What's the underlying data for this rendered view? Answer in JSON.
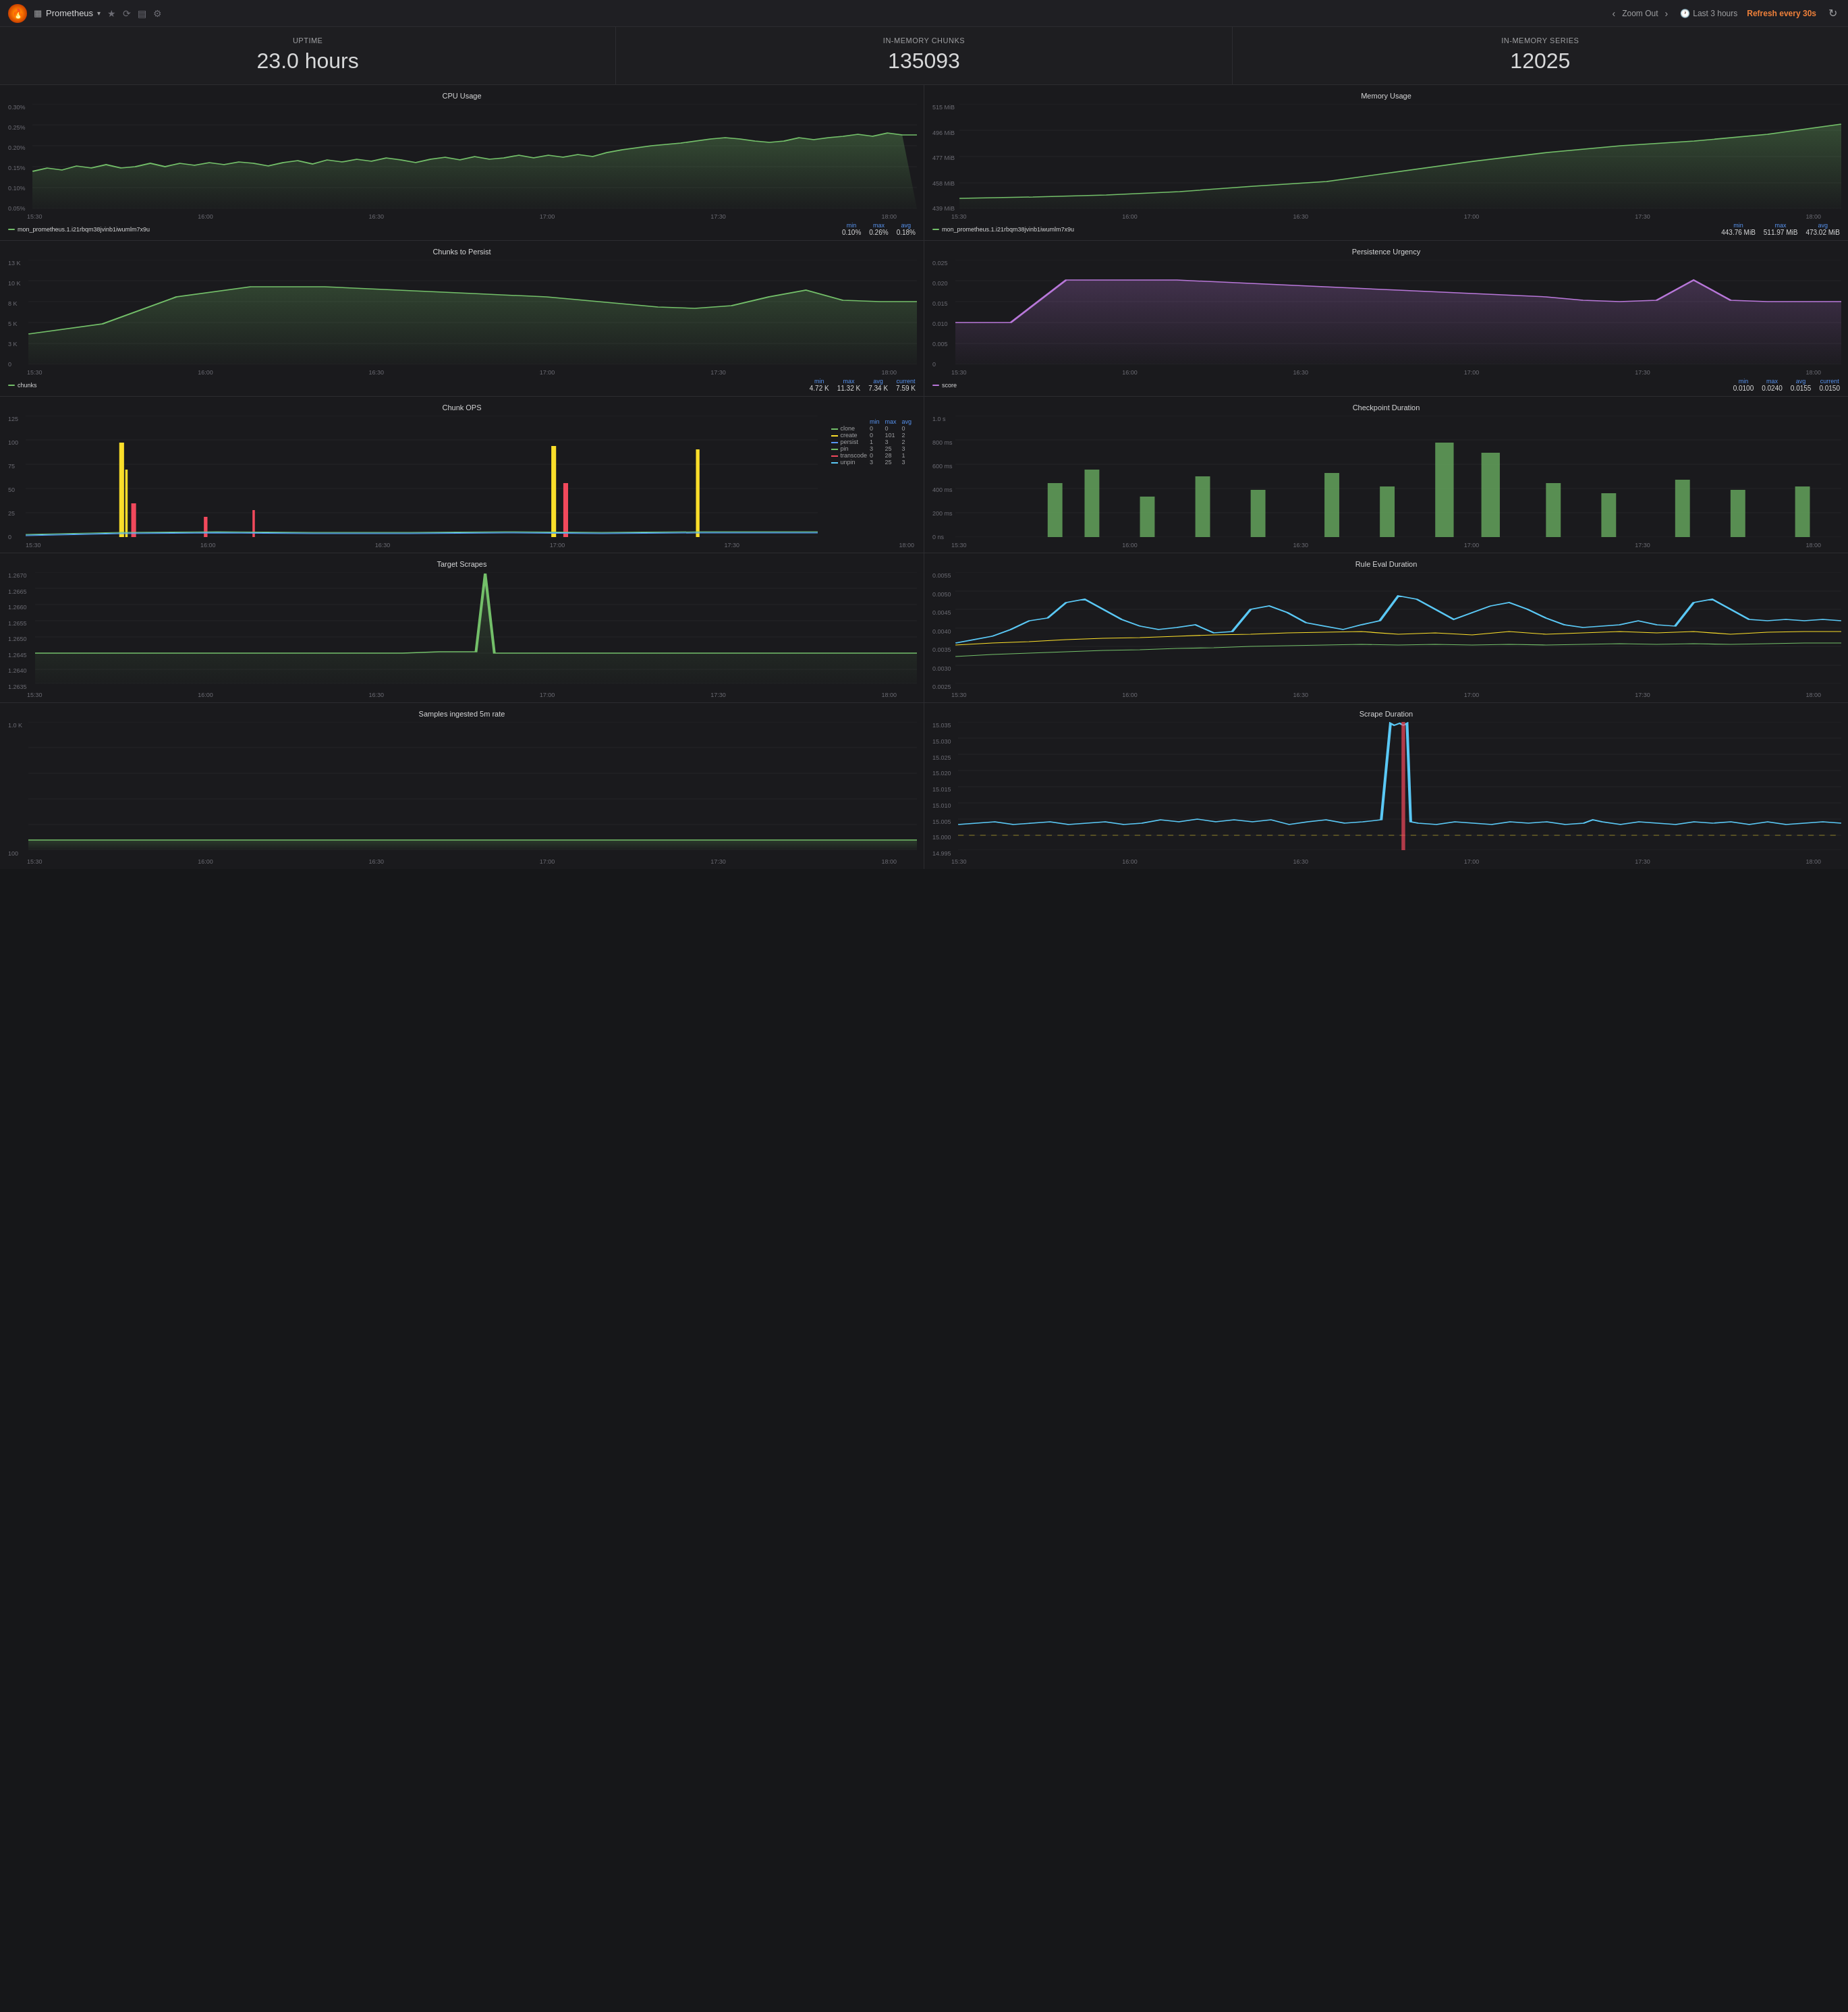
{
  "header": {
    "logo": "🔥",
    "title": "Prometheus",
    "title_dropdown": "▾",
    "icons": [
      "★",
      "↻",
      "▤",
      "⚙"
    ],
    "zoom_out": "Zoom Out",
    "time_range": "Last 3 hours",
    "refresh": "Refresh every 30s",
    "nav_left": "‹",
    "nav_right": "›"
  },
  "stats": [
    {
      "label": "Uptime",
      "value": "23.0 hours"
    },
    {
      "label": "In-Memory Chunks",
      "value": "135093"
    },
    {
      "label": "In-Memory Series",
      "value": "12025"
    }
  ],
  "charts": [
    {
      "id": "cpu-usage",
      "title": "CPU Usage",
      "y_labels": [
        "0.30%",
        "0.25%",
        "0.20%",
        "0.15%",
        "0.10%",
        "0.05%"
      ],
      "x_labels": [
        "15:30",
        "16:00",
        "16:30",
        "17:00",
        "17:30",
        "18:00"
      ],
      "legend_name": "mon_prometheus.1.i21rbqm38jvinb1iwumlm7x9u",
      "legend_color": "#73bf69",
      "min": "0.10%",
      "max": "0.26%",
      "avg": "0.18%",
      "type": "line",
      "color": "#73bf69"
    },
    {
      "id": "memory-usage",
      "title": "Memory Usage",
      "y_labels": [
        "515 MiB",
        "496 MiB",
        "477 MiB",
        "458 MiB",
        "439 MiB"
      ],
      "x_labels": [
        "15:30",
        "16:00",
        "16:30",
        "17:00",
        "17:30",
        "18:00"
      ],
      "legend_name": "mon_prometheus.1.i21rbqm38jvinb1iwumlm7x9u",
      "legend_color": "#73bf69",
      "min": "443.76 MiB",
      "max": "511.97 MiB",
      "avg": "473.02 MiB",
      "type": "line",
      "color": "#73bf69"
    },
    {
      "id": "chunks-to-persist",
      "title": "Chunks to Persist",
      "y_labels": [
        "13 K",
        "10 K",
        "8 K",
        "5 K",
        "3 K",
        "0"
      ],
      "x_labels": [
        "15:30",
        "16:00",
        "16:30",
        "17:00",
        "17:30",
        "18:00"
      ],
      "legend_name": "chunks",
      "legend_color": "#73bf69",
      "min": "4.72 K",
      "max": "11.32 K",
      "avg": "7.34 K",
      "current": "7.59 K",
      "type": "line",
      "color": "#73bf69"
    },
    {
      "id": "persistence-urgency",
      "title": "Persistence Urgency",
      "y_labels": [
        "0.025",
        "0.020",
        "0.015",
        "0.010",
        "0.005",
        "0"
      ],
      "x_labels": [
        "15:30",
        "16:00",
        "16:30",
        "17:00",
        "17:30",
        "18:00"
      ],
      "legend_name": "score",
      "legend_color": "#b877d9",
      "min": "0.0100",
      "max": "0.0240",
      "avg": "0.0155",
      "current": "0.0150",
      "type": "line",
      "color": "#b877d9"
    },
    {
      "id": "chunk-ops",
      "title": "Chunk OPS",
      "y_labels": [
        "125",
        "100",
        "75",
        "50",
        "25",
        "0"
      ],
      "x_labels": [
        "15:30",
        "16:00",
        "16:30",
        "17:00",
        "17:30",
        "18:00"
      ],
      "series": [
        {
          "name": "clone",
          "color": "#73bf69",
          "min": 0,
          "max": 0,
          "avg": 0
        },
        {
          "name": "create",
          "color": "#fade2a",
          "min": 0,
          "max": 101,
          "avg": 2
        },
        {
          "name": "persist",
          "color": "#5794f2",
          "min": 1,
          "max": 3,
          "avg": 2
        },
        {
          "name": "pin",
          "color": "#73bf69",
          "min": 3,
          "max": 25,
          "avg": 3
        },
        {
          "name": "transcode",
          "color": "#f2495c",
          "min": 0,
          "max": 28,
          "avg": 1
        },
        {
          "name": "unpin",
          "color": "#5ac8f5",
          "min": 3,
          "max": 25,
          "avg": 3
        }
      ],
      "type": "multi-line"
    },
    {
      "id": "checkpoint-duration",
      "title": "Checkpoint Duration",
      "y_labels": [
        "1.0 s",
        "800 ms",
        "600 ms",
        "400 ms",
        "200 ms",
        "0 ns"
      ],
      "x_labels": [
        "15:30",
        "16:00",
        "16:30",
        "17:00",
        "17:30",
        "18:00"
      ],
      "legend_color": "#73bf69",
      "type": "bar"
    },
    {
      "id": "target-scrapes",
      "title": "Target Scrapes",
      "y_labels": [
        "1.2670",
        "1.2665",
        "1.2660",
        "1.2655",
        "1.2650",
        "1.2645",
        "1.2640",
        "1.2635"
      ],
      "x_labels": [
        "15:30",
        "16:00",
        "16:30",
        "17:00",
        "17:30",
        "18:00"
      ],
      "legend_color": "#73bf69",
      "type": "line",
      "color": "#73bf69"
    },
    {
      "id": "rule-eval-duration",
      "title": "Rule Eval Duration",
      "y_labels": [
        "0.0055",
        "0.0050",
        "0.0045",
        "0.0040",
        "0.0035",
        "0.0030",
        "0.0025"
      ],
      "x_labels": [
        "15:30",
        "16:00",
        "16:30",
        "17:00",
        "17:30",
        "18:00"
      ],
      "colors": [
        "#5ac8f5",
        "#fade2a",
        "#73bf69"
      ],
      "type": "multi-line"
    },
    {
      "id": "samples-ingested",
      "title": "Samples ingested 5m rate",
      "y_labels": [
        "1.0 K",
        "",
        "",
        "",
        "",
        "100"
      ],
      "x_labels": [
        "15:30",
        "16:00",
        "16:30",
        "17:00",
        "17:30",
        "18:00"
      ],
      "legend_color": "#73bf69",
      "type": "line",
      "color": "#73bf69"
    },
    {
      "id": "scrape-duration",
      "title": "Scrape Duration",
      "y_labels": [
        "15.035",
        "15.030",
        "15.025",
        "15.020",
        "15.015",
        "15.010",
        "15.005",
        "15.000",
        "14.995"
      ],
      "x_labels": [
        "15:30",
        "16:00",
        "16:30",
        "17:00",
        "17:30",
        "18:00"
      ],
      "legend_color": "#5ac8f5",
      "type": "line",
      "color": "#5ac8f5"
    }
  ]
}
